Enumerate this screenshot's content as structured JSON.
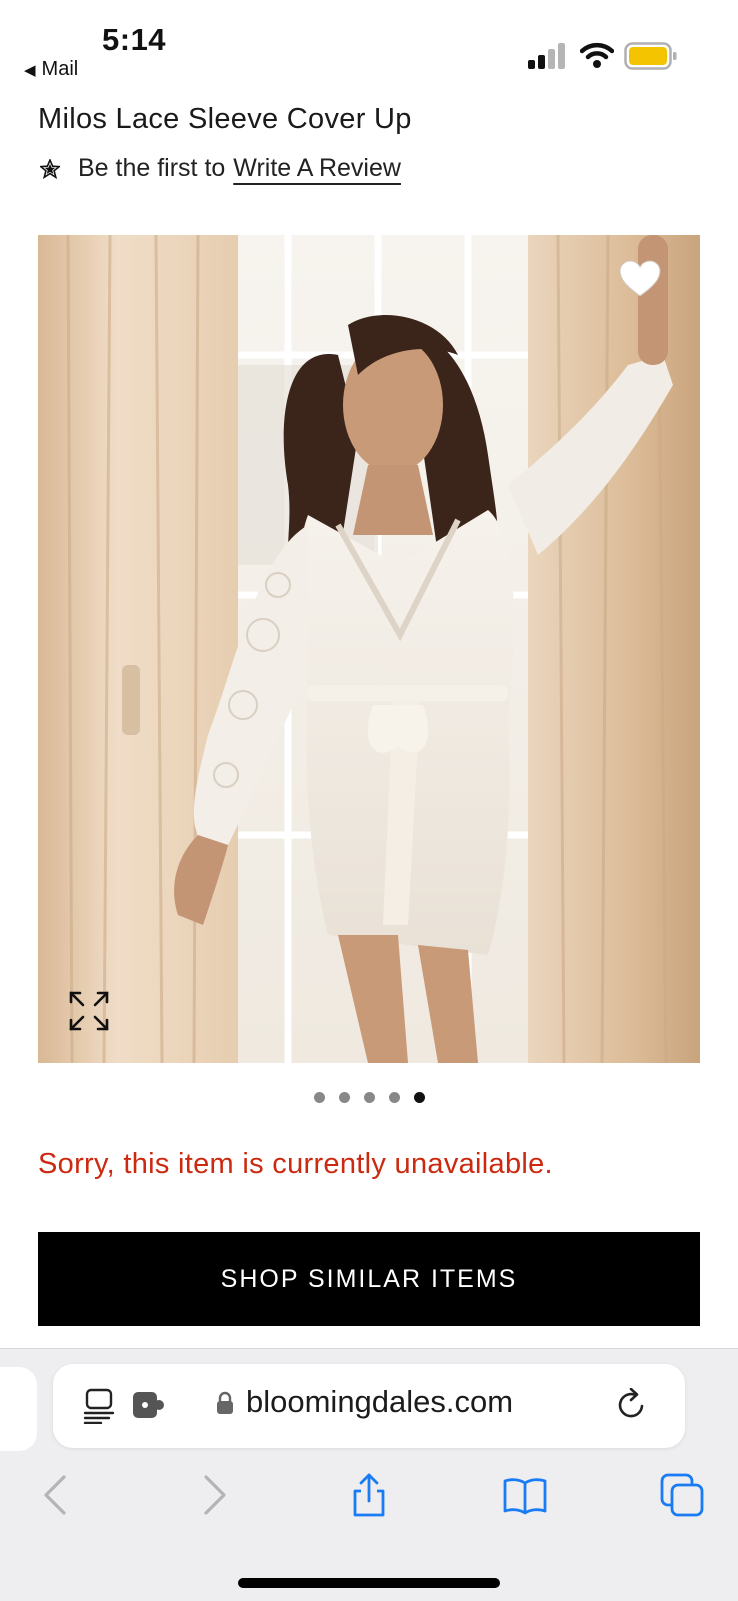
{
  "status_bar": {
    "time": "5:14",
    "back_label": "Mail",
    "battery_color": "#f5c400"
  },
  "product": {
    "title": "Milos Lace Sleeve Cover Up",
    "review_prefix": "Be the first to",
    "review_link": "Write A Review",
    "image_icons": [
      "heart-icon",
      "expand-icon"
    ],
    "carousel": {
      "total": 5,
      "active_index": 4
    },
    "unavailable_message": "Sorry, this item is currently unavailable.",
    "shop_similar_label": "SHOP SIMILAR ITEMS",
    "error_color": "#cc2a10"
  },
  "browser": {
    "domain": "bloomingdales.com",
    "icons": [
      "reader-icon",
      "extension-icon",
      "lock-icon",
      "reload-icon"
    ],
    "toolbar": [
      "back-icon",
      "forward-icon",
      "share-icon",
      "bookmarks-icon",
      "tabs-icon"
    ],
    "accent_color": "#1a7cf5"
  }
}
